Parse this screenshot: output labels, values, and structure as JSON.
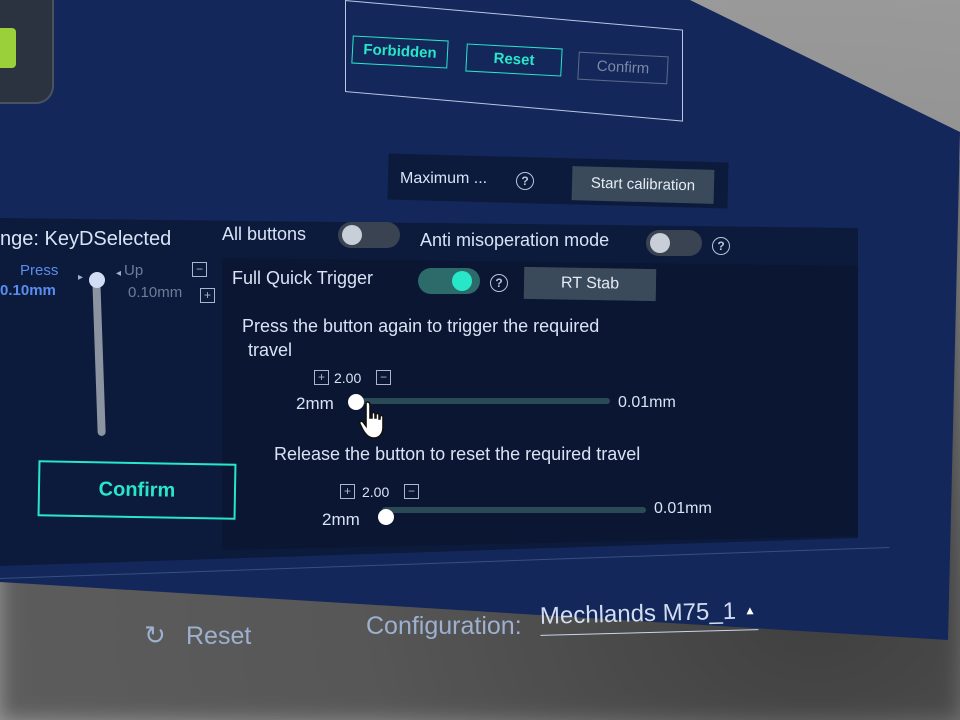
{
  "dialog": {
    "forbidden_label": "Forbidden",
    "reset_label": "Reset",
    "confirm_label": "Confirm"
  },
  "calibration": {
    "maximum_label": "Maximum ...",
    "start_label": "Start calibration"
  },
  "key_panel": {
    "range_label": "nge: KeyDSelected",
    "press_label": "Press",
    "press_value": "0.10mm",
    "up_label": "Up",
    "up_value": "0.10mm",
    "confirm_label": "Confirm"
  },
  "options": {
    "all_buttons_label": "All buttons",
    "all_buttons_on": false,
    "anti_misoperation_label": "Anti misoperation mode",
    "anti_misoperation_on": false,
    "full_quick_trigger_label": "Full Quick Trigger",
    "full_quick_trigger_on": true,
    "rt_stab_label": "RT Stab"
  },
  "trigger": {
    "instruction": "Press the button again to trigger the required",
    "instruction_cont": "travel",
    "value": "2.00",
    "min_label": "2mm",
    "max_label": "0.01mm"
  },
  "release": {
    "instruction": "Release the button to reset the required travel",
    "value": "2.00",
    "min_label": "2mm",
    "max_label": "0.01mm"
  },
  "footer": {
    "reset_label": "Reset",
    "config_label": "Configuration:",
    "config_value": "Mechlands M75_1"
  },
  "colors": {
    "panel_bg": "#13275a",
    "accent": "#28e7c9",
    "dark_box": "#0c1a3c"
  }
}
